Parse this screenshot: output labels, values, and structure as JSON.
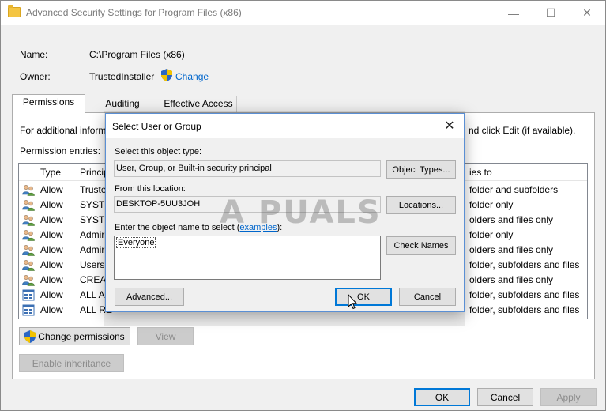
{
  "window": {
    "title": "Advanced Security Settings for Program Files (x86)",
    "minimize_glyph": "—",
    "maximize_glyph": "☐",
    "close_glyph": "✕"
  },
  "info": {
    "name_label": "Name:",
    "name_value": "C:\\Program Files (x86)",
    "owner_label": "Owner:",
    "owner_value": "TrustedInstaller",
    "change_link": "Change"
  },
  "tabs": [
    {
      "label": "Permissions",
      "active": true
    },
    {
      "label": "Auditing",
      "active": false
    },
    {
      "label": "Effective Access",
      "active": false
    }
  ],
  "permissions": {
    "info_text_left": "For additional inform",
    "info_text_right": "nd click Edit (if available).",
    "entries_label": "Permission entries:",
    "columns": {
      "type": "Type",
      "principal": "Princip",
      "applies": "ies to"
    },
    "rows": [
      {
        "type": "Allow",
        "principal": "Truste",
        "applies": "folder and subfolders",
        "icon": "users-icon"
      },
      {
        "type": "Allow",
        "principal": "SYSTE",
        "applies": "folder only",
        "icon": "users-icon"
      },
      {
        "type": "Allow",
        "principal": "SYSTE",
        "applies": "olders and files only",
        "icon": "users-icon"
      },
      {
        "type": "Allow",
        "principal": "Admir",
        "applies": "folder only",
        "icon": "users-icon"
      },
      {
        "type": "Allow",
        "principal": "Admir",
        "applies": "olders and files only",
        "icon": "users-icon"
      },
      {
        "type": "Allow",
        "principal": "Users",
        "applies": "folder, subfolders and files",
        "icon": "users-icon"
      },
      {
        "type": "Allow",
        "principal": "CREAT",
        "applies": "olders and files only",
        "icon": "users-icon"
      },
      {
        "type": "Allow",
        "principal": "ALL A",
        "applies": "folder, subfolders and files",
        "icon": "app-package-icon"
      },
      {
        "type": "Allow",
        "principal": "ALL RE",
        "applies": "folder, subfolders and files",
        "icon": "app-package-icon"
      }
    ],
    "change_permissions_button": "Change permissions",
    "view_button": "View",
    "enable_inheritance_button": "Enable inheritance"
  },
  "footer": {
    "ok": "OK",
    "cancel": "Cancel",
    "apply": "Apply"
  },
  "dialog": {
    "title": "Select User or Group",
    "close_glyph": "✕",
    "object_type_label": "Select this object type:",
    "object_type_value": "User, Group, or Built-in security principal",
    "object_types_button": "Object Types...",
    "location_label": "From this location:",
    "location_value": "DESKTOP-5UU3JOH",
    "locations_button": "Locations...",
    "enter_name_label_prefix": "Enter the object name to select (",
    "examples_link": "examples",
    "enter_name_label_suffix": "):",
    "object_name_value": "Everyone",
    "check_names_button": "Check Names",
    "advanced_button": "Advanced...",
    "ok_button": "OK",
    "cancel_button": "Cancel"
  },
  "watermark": {
    "text": "A  PUALS"
  },
  "colors": {
    "link": "#0066cc",
    "accent": "#0078d7"
  }
}
